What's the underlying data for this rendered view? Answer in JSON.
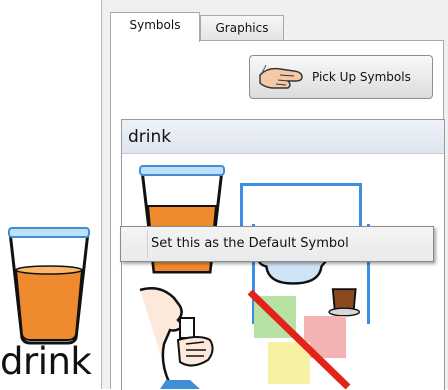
{
  "preview": {
    "label": "drink",
    "symbol": "glass-of-juice-icon"
  },
  "tabs": [
    {
      "label": "Symbols",
      "active": true
    },
    {
      "label": "Graphics",
      "active": false
    }
  ],
  "pickup": {
    "label": "Pick Up Symbols",
    "icon": "hand-pickup-icon"
  },
  "results": {
    "header": "drink",
    "symbols": [
      {
        "name": "glass-of-juice-icon",
        "selected": false
      },
      {
        "name": "teapot-and-cup-icon",
        "selected": true
      },
      {
        "name": "person-drinking-icon",
        "selected": false
      },
      {
        "name": "cancelled-squares-icon",
        "selected": false
      }
    ]
  },
  "context_menu": {
    "items": [
      "Set this as the Default Symbol"
    ]
  },
  "colors": {
    "accent": "#3b8ee8",
    "juice": "#f08a2e",
    "glass_rim": "#3f8fd6",
    "cancel_line": "#e2231a"
  }
}
